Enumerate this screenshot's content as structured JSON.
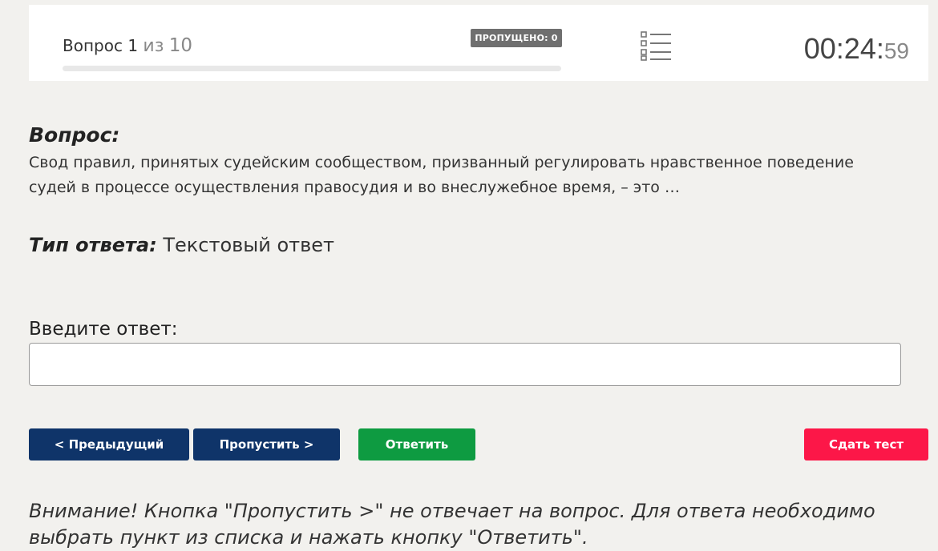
{
  "header": {
    "question_word": "Вопрос",
    "current": "1",
    "of_word": "из",
    "total": "10",
    "progress_fraction": 0.0,
    "skipped_badge": "ПРОПУЩЕНО: 0",
    "list_icon": "list-icon",
    "timer_main": "00:24:",
    "timer_seconds": "59"
  },
  "question": {
    "label": "Вопрос:",
    "text": "Свод правил, принятых судейским сообществом, призванный регулировать нравственное поведение судей в процессе осуществления правосудия и во внеслужебное время, – это …"
  },
  "answer_type": {
    "label": "Тип ответа:",
    "value": "Текстовый ответ"
  },
  "answer_input": {
    "label": "Введите ответ:",
    "value": "",
    "placeholder": ""
  },
  "buttons": {
    "prev": "< Предыдущий",
    "skip": "Пропустить >",
    "answer": "Ответить",
    "submit": "Сдать тест"
  },
  "warning": "Внимание! Кнопка \"Пропустить >\" не отвечает на вопрос. Для ответа необходимо выбрать пункт из списка и нажать кнопку \"Ответить\".",
  "colors": {
    "background": "#f2f1ee",
    "primary_button": "#0f3469",
    "answer_button": "#0e9b41",
    "submit_button": "#fc1748",
    "badge": "#6f6f6f"
  }
}
